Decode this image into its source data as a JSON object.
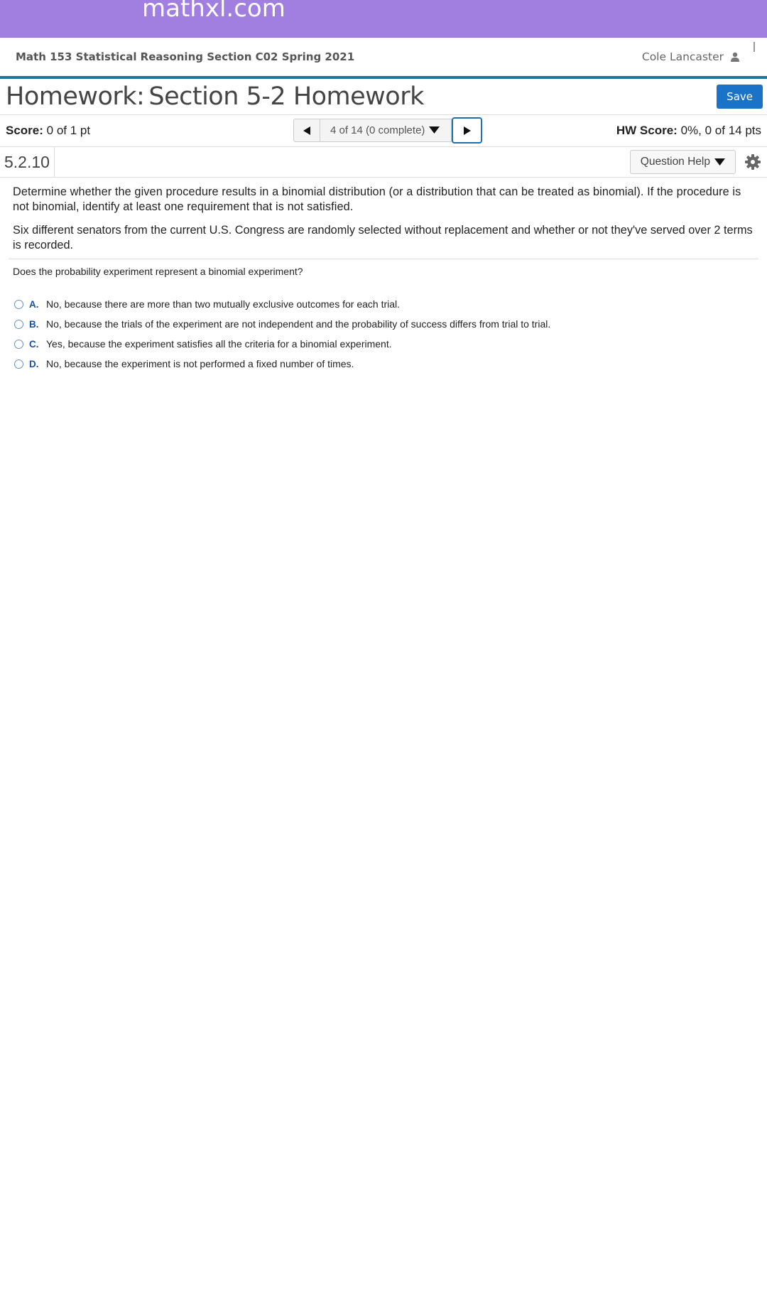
{
  "header": {
    "brand": "mathxl.com"
  },
  "course": {
    "title": "Math 153 Statistical Reasoning Section C02 Spring 2021",
    "user_name": "Cole Lancaster"
  },
  "homework": {
    "label": "Homework:",
    "name": "Section 5-2 Homework",
    "save_label": "Save"
  },
  "score": {
    "label": "Score:",
    "value": "0 of 1 pt",
    "hw_label": "HW Score:",
    "hw_value": "0%, 0 of 14 pts"
  },
  "navigation": {
    "position": "4 of 14 (0 complete)"
  },
  "question": {
    "number": "5.2.10",
    "help_label": "Question Help",
    "instructions": "Determine whether the given procedure results in a binomial distribution (or a distribution that can be treated as binomial). If the procedure is not binomial, identify at least one requirement that is not satisfied.",
    "scenario": "Six different senators from the current U.S. Congress are randomly selected without replacement and whether or not they've served over 2 terms is recorded.",
    "prompt": "Does the probability experiment represent a binomial experiment?",
    "choices": [
      {
        "letter": "A.",
        "text": "No, because there are more than two mutually exclusive outcomes for each trial."
      },
      {
        "letter": "B.",
        "text": "No, because the trials of the experiment are not independent and the probability of success differs from trial to trial."
      },
      {
        "letter": "C.",
        "text": "Yes, because the experiment satisfies all the criteria for a binomial experiment."
      },
      {
        "letter": "D.",
        "text": "No, because the experiment is not performed a fixed number of times."
      }
    ]
  },
  "icons": {
    "user": "user-icon",
    "prev": "triangle-left-icon",
    "next": "triangle-right-icon",
    "dropdown": "triangle-down-icon",
    "settings": "gear-icon"
  },
  "colors": {
    "header": "#a07fe0",
    "accent_line": "#1f7596",
    "save_button": "#1a73c6",
    "choice_letter": "#1a4fa0"
  }
}
